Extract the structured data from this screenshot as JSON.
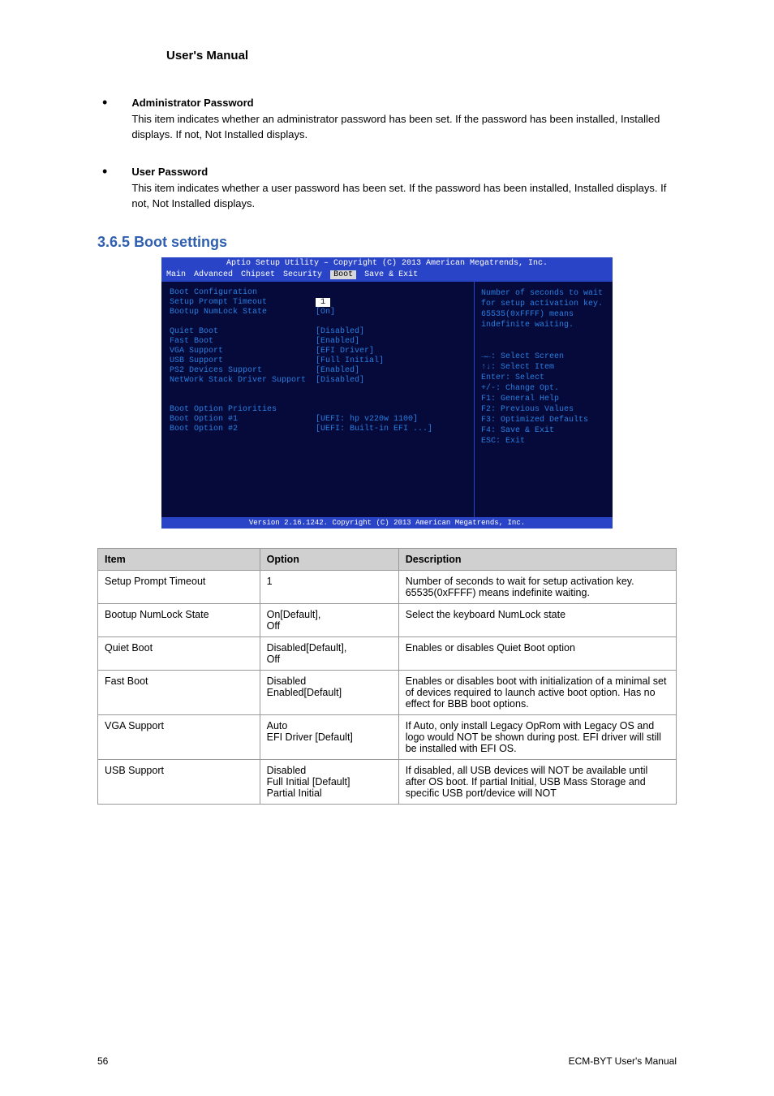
{
  "header": {
    "title": "User's Manual"
  },
  "bullets": [
    {
      "title": "Administrator Password",
      "text": "This item indicates whether an administrator password has been set. If the password has been installed, Installed displays. If not, Not Installed displays."
    },
    {
      "title": "User Password",
      "text": "This item indicates whether a user password has been set. If the password has been installed, Installed displays. If not, Not Installed displays."
    }
  ],
  "section": {
    "number": "3.6.5",
    "title": "Boot settings"
  },
  "bios": {
    "topbar": "Aptio Setup Utility – Copyright (C) 2013 American Megatrends, Inc.",
    "menu": [
      "Main",
      "Advanced",
      "Chipset",
      "Security",
      "Boot",
      "Save & Exit"
    ],
    "rows": [
      {
        "label": "Boot Configuration",
        "value": ""
      },
      {
        "label": "Setup Prompt Timeout",
        "value": "1",
        "hl": true
      },
      {
        "label": "Bootup NumLock State",
        "value": "[On]"
      },
      {
        "label": "",
        "value": ""
      },
      {
        "label": "Quiet Boot",
        "value": "[Disabled]"
      },
      {
        "label": "Fast Boot",
        "value": "[Enabled]"
      },
      {
        "label": "  VGA Support",
        "value": "[EFI Driver]"
      },
      {
        "label": "  USB Support",
        "value": "[Full Initial]"
      },
      {
        "label": "  PS2 Devices Support",
        "value": "[Enabled]"
      },
      {
        "label": "  NetWork Stack Driver Support",
        "value": "[Disabled]"
      },
      {
        "label": "",
        "value": ""
      },
      {
        "label": "",
        "value": ""
      },
      {
        "label": "Boot Option Priorities",
        "value": ""
      },
      {
        "label": "Boot Option #1",
        "value": "[UEFI: hp v220w 1100]"
      },
      {
        "label": "Boot Option #2",
        "value": "[UEFI: Built-in EFI ...]"
      }
    ],
    "help": "Number of seconds to wait for setup activation key. 65535(0xFFFF) means indefinite waiting.",
    "keys": [
      "→←: Select Screen",
      "↑↓: Select Item",
      "Enter: Select",
      "+/-: Change Opt.",
      "F1: General Help",
      "F2: Previous Values",
      "F3: Optimized Defaults",
      "F4: Save & Exit",
      "ESC: Exit"
    ],
    "footer": "Version 2.16.1242. Copyright (C) 2013 American Megatrends, Inc."
  },
  "table": {
    "head": [
      "Item",
      "Option",
      "Description"
    ],
    "rows": [
      [
        "Setup Prompt Timeout",
        "1",
        "Number of seconds to wait for setup activation key. 65535(0xFFFF) means indefinite waiting."
      ],
      [
        "Bootup NumLock State",
        "On[Default],\nOff",
        "Select the keyboard NumLock state"
      ],
      [
        "Quiet Boot",
        "Disabled[Default],\nOff",
        "Enables or disables Quiet Boot option"
      ],
      [
        "Fast Boot",
        "Disabled\nEnabled[Default]",
        "Enables or disables boot with initialization of a minimal set of devices required to launch active boot option. Has no effect for BBB boot options."
      ],
      [
        "VGA Support",
        "Auto\nEFI Driver [Default]",
        "If Auto, only install Legacy OpRom with Legacy OS and logo would NOT be shown during post. EFI driver will still be installed with EFI OS."
      ],
      [
        "USB Support",
        "Disabled\nFull Initial [Default]\nPartial Initial",
        "If disabled, all USB devices will NOT be available until after OS boot. If partial Initial, USB Mass Storage and specific USB port/device will NOT"
      ]
    ]
  },
  "footer": {
    "left": "56",
    "right": "ECM-BYT User's Manual"
  }
}
